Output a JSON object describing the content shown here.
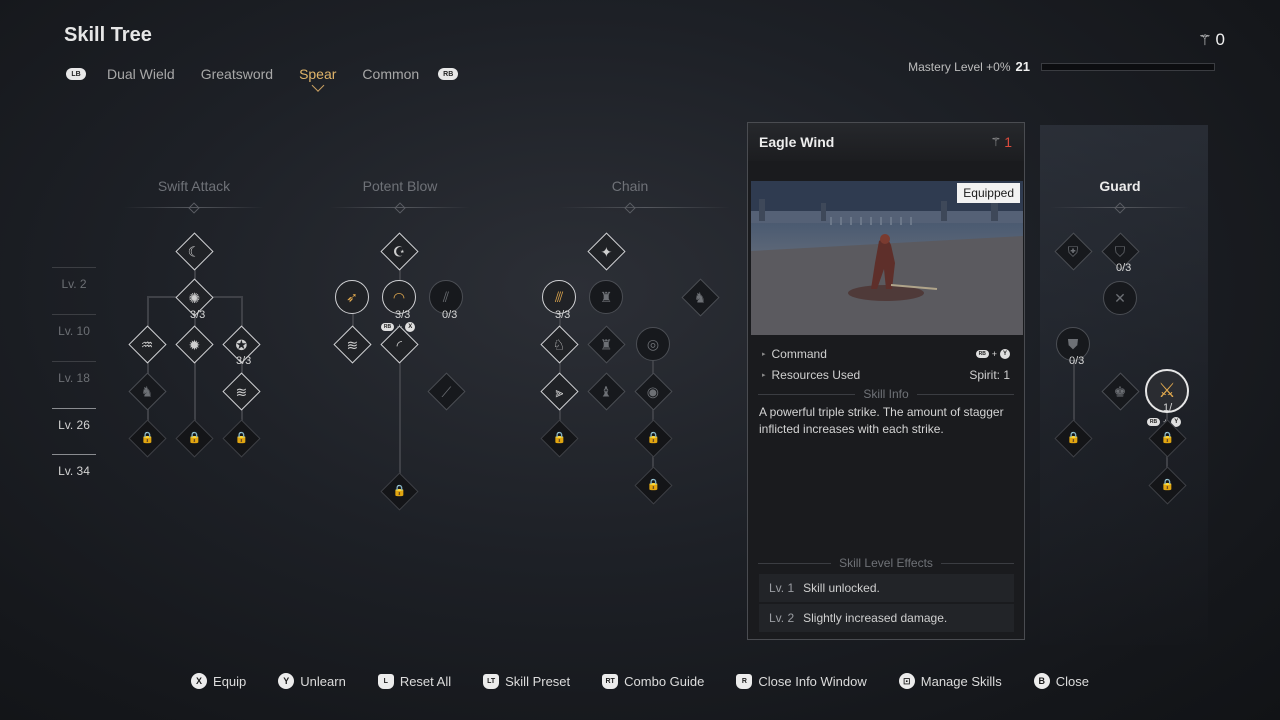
{
  "header": {
    "title": "Skill Tree",
    "currency_value": "0",
    "currency_icon": "feather-icon"
  },
  "tabs": {
    "left_bumper": "LB",
    "right_bumper": "RB",
    "items": [
      {
        "label": "Dual Wield",
        "active": false
      },
      {
        "label": "Greatsword",
        "active": false
      },
      {
        "label": "Spear",
        "active": true
      },
      {
        "label": "Common",
        "active": false
      }
    ]
  },
  "mastery": {
    "label": "Mastery Level +0%",
    "level": "21",
    "progress": 0
  },
  "columns": [
    "Swift Attack",
    "Potent Blow",
    "Chain",
    "Guard"
  ],
  "levels": [
    "Lv. 2",
    "Lv. 10",
    "Lv. 18",
    "Lv. 26",
    "Lv. 34"
  ],
  "counts": {
    "swift_top": "3/3",
    "swift_right": "3/3",
    "potent_mid": "3/3",
    "potent_right": "0/3",
    "chain_left": "3/3",
    "guard_top": "0/3",
    "guard_mid": "0/3",
    "guard_selected": "1/"
  },
  "mini_commands": {
    "potent": {
      "trigger": "RB",
      "plus": "+",
      "button": "X"
    },
    "guard": {
      "trigger": "RB",
      "plus": "+",
      "button": "Y"
    }
  },
  "info": {
    "name": "Eagle Wind",
    "cost": "1",
    "equipped": "Equipped",
    "command_label": "Command",
    "command": {
      "trigger": "RB",
      "plus": "+",
      "button": "Y"
    },
    "resources_label": "Resources Used",
    "resources_value": "Spirit: 1",
    "skill_info_header": "Skill Info",
    "description": "A powerful triple strike. The amount of stagger inflicted increases with each strike.",
    "effects_header": "Skill Level Effects",
    "effects": [
      {
        "level": "Lv. 1",
        "text": "Skill unlocked."
      },
      {
        "level": "Lv. 2",
        "text": "Slightly increased damage."
      }
    ]
  },
  "footer": [
    {
      "button": "X",
      "label": "Equip",
      "shape": "circle"
    },
    {
      "button": "Y",
      "label": "Unlearn",
      "shape": "circle"
    },
    {
      "button": "L",
      "label": "Reset All",
      "shape": "stick"
    },
    {
      "button": "LT",
      "label": "Skill Preset",
      "shape": "trigger"
    },
    {
      "button": "RT",
      "label": "Combo Guide",
      "shape": "trigger"
    },
    {
      "button": "R",
      "label": "Close Info Window",
      "shape": "stick"
    },
    {
      "button": "⊡",
      "label": "Manage Skills",
      "shape": "circle"
    },
    {
      "button": "B",
      "label": "Close",
      "shape": "circle"
    }
  ]
}
